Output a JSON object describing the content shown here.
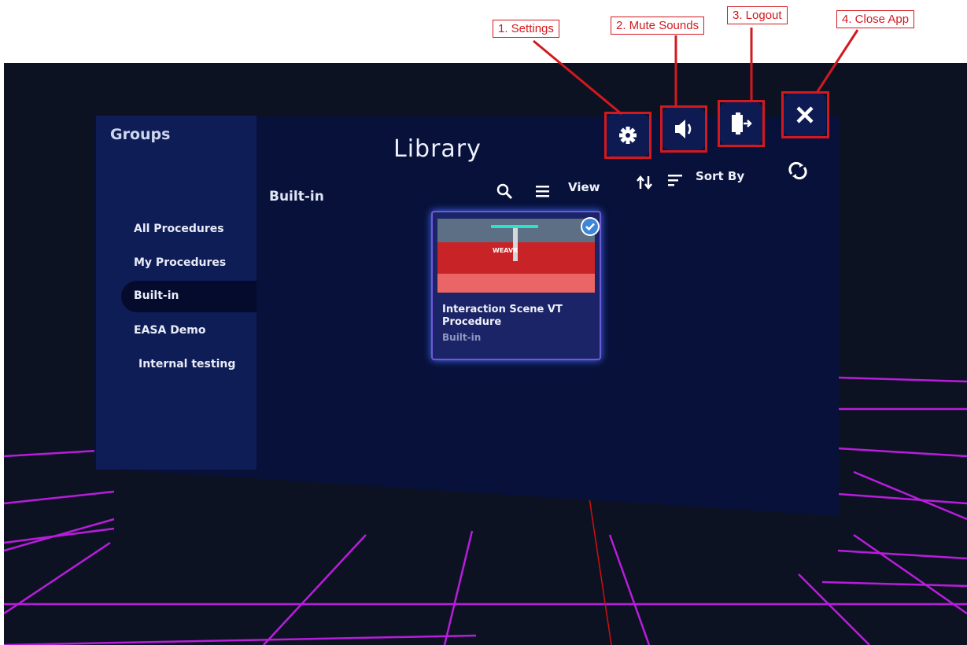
{
  "header": {
    "title": "Library"
  },
  "annotations": {
    "settings": "1. Settings",
    "mute": "2. Mute Sounds",
    "logout": "3. Logout",
    "close": "4. Close App"
  },
  "groups": {
    "title": "Groups",
    "items": [
      {
        "label": "All Procedures"
      },
      {
        "label": "My Procedures"
      },
      {
        "label": "Built-in",
        "active": true
      },
      {
        "label": "EASA Demo"
      },
      {
        "label": "Internal testing"
      }
    ]
  },
  "content": {
    "title": "Built-in",
    "view_label": "View",
    "sort_label": "Sort By"
  },
  "card": {
    "title": "Interaction Scene VT Procedure",
    "subtitle": "Built-in",
    "thumb_logo_text": "WEAVR",
    "selected": true
  },
  "icons": {
    "settings": "gear-icon",
    "mute": "speaker-icon",
    "logout": "logout-door-icon",
    "close": "close-icon",
    "search": "search-icon",
    "view": "list-icon",
    "sort_order": "sort-arrows-icon",
    "sort": "sort-lines-icon",
    "refresh": "refresh-icon"
  },
  "colors": {
    "background": "#0c1222",
    "grid": "#b81ddb",
    "panel": "#07113a",
    "sidebar": "#0e1d56",
    "callout": "#d3191f",
    "card_border": "#6d5ad8"
  }
}
